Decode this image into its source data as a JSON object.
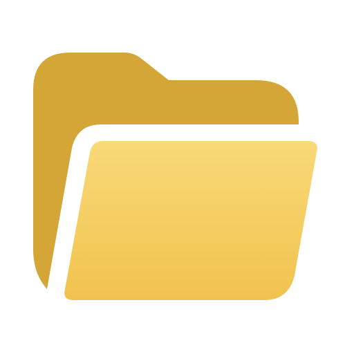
{
  "icon": {
    "name": "folder-open-icon",
    "colors": {
      "back": "#D4A638",
      "front_top": "#F8DA78",
      "front_bottom": "#F1C24E",
      "background": "#FFFFFF"
    }
  }
}
